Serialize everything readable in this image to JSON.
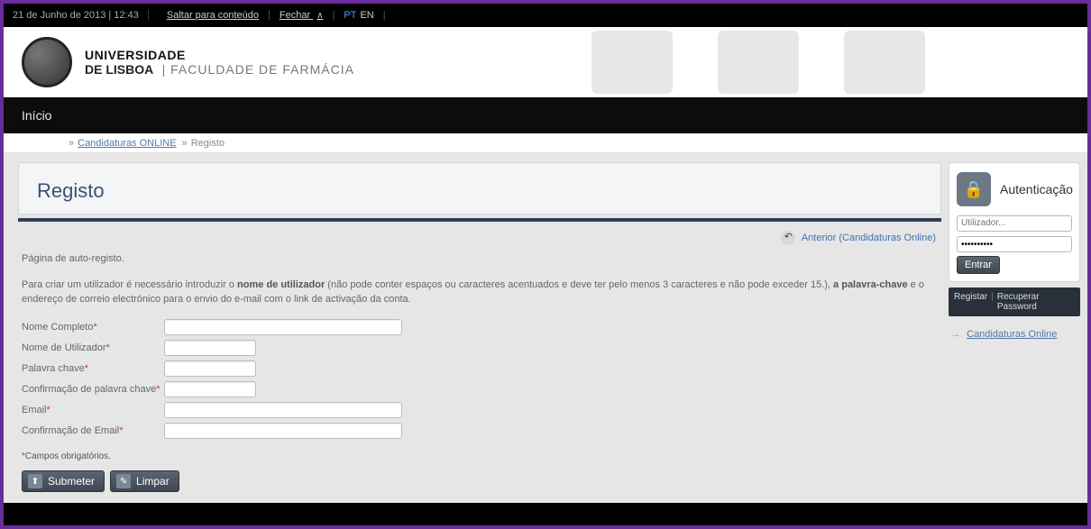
{
  "topbar": {
    "date": "21 de Junho de 2013 | 12:43",
    "skip": "Saltar para conteúdo",
    "close": "Fechar",
    "lang_pt": "PT",
    "lang_en": "EN"
  },
  "header": {
    "uni_line1": "UNIVERSIDADE",
    "uni_line2": "DE LISBOA",
    "faculty": "| FACULDADE DE FARMÁCIA"
  },
  "nav": {
    "home": "Início"
  },
  "crumbs": {
    "link1": "Candidaturas ONLINE",
    "current": "Registo"
  },
  "page": {
    "title": "Registo",
    "back_label": "Anterior (Candidaturas Online)",
    "intro": "Página de auto-registo.",
    "info_pre": "Para criar um utilizador é necessário introduzir o ",
    "info_b1": "nome de utilizador",
    "info_mid": " (não pode conter espaços ou caracteres acentuados e deve ter pelo menos 3 caracteres e não pode exceder 15.), ",
    "info_b2": "a palavra-chave",
    "info_post": " e o endereço de correio electrónico para o envio do e-mail com o link de activação da conta."
  },
  "form": {
    "nome_completo": "Nome Completo",
    "nome_utilizador": "Nome de Utilizador",
    "palavra_chave": "Palavra chave",
    "conf_palavra": "Confirmação de palavra chave",
    "email": "Email",
    "conf_email": "Confirmação de Email",
    "required_note": "Campos obrigatórios.",
    "submit": "Submeter",
    "clear": "Limpar"
  },
  "sidebar": {
    "auth_title": "Autenticação",
    "user_placeholder": "Utilizador...",
    "pass_value": "••••••••••",
    "enter": "Entrar",
    "registar": "Registar",
    "recuperar": "Recuperar Password",
    "cand_online": "Candidaturas Online"
  }
}
